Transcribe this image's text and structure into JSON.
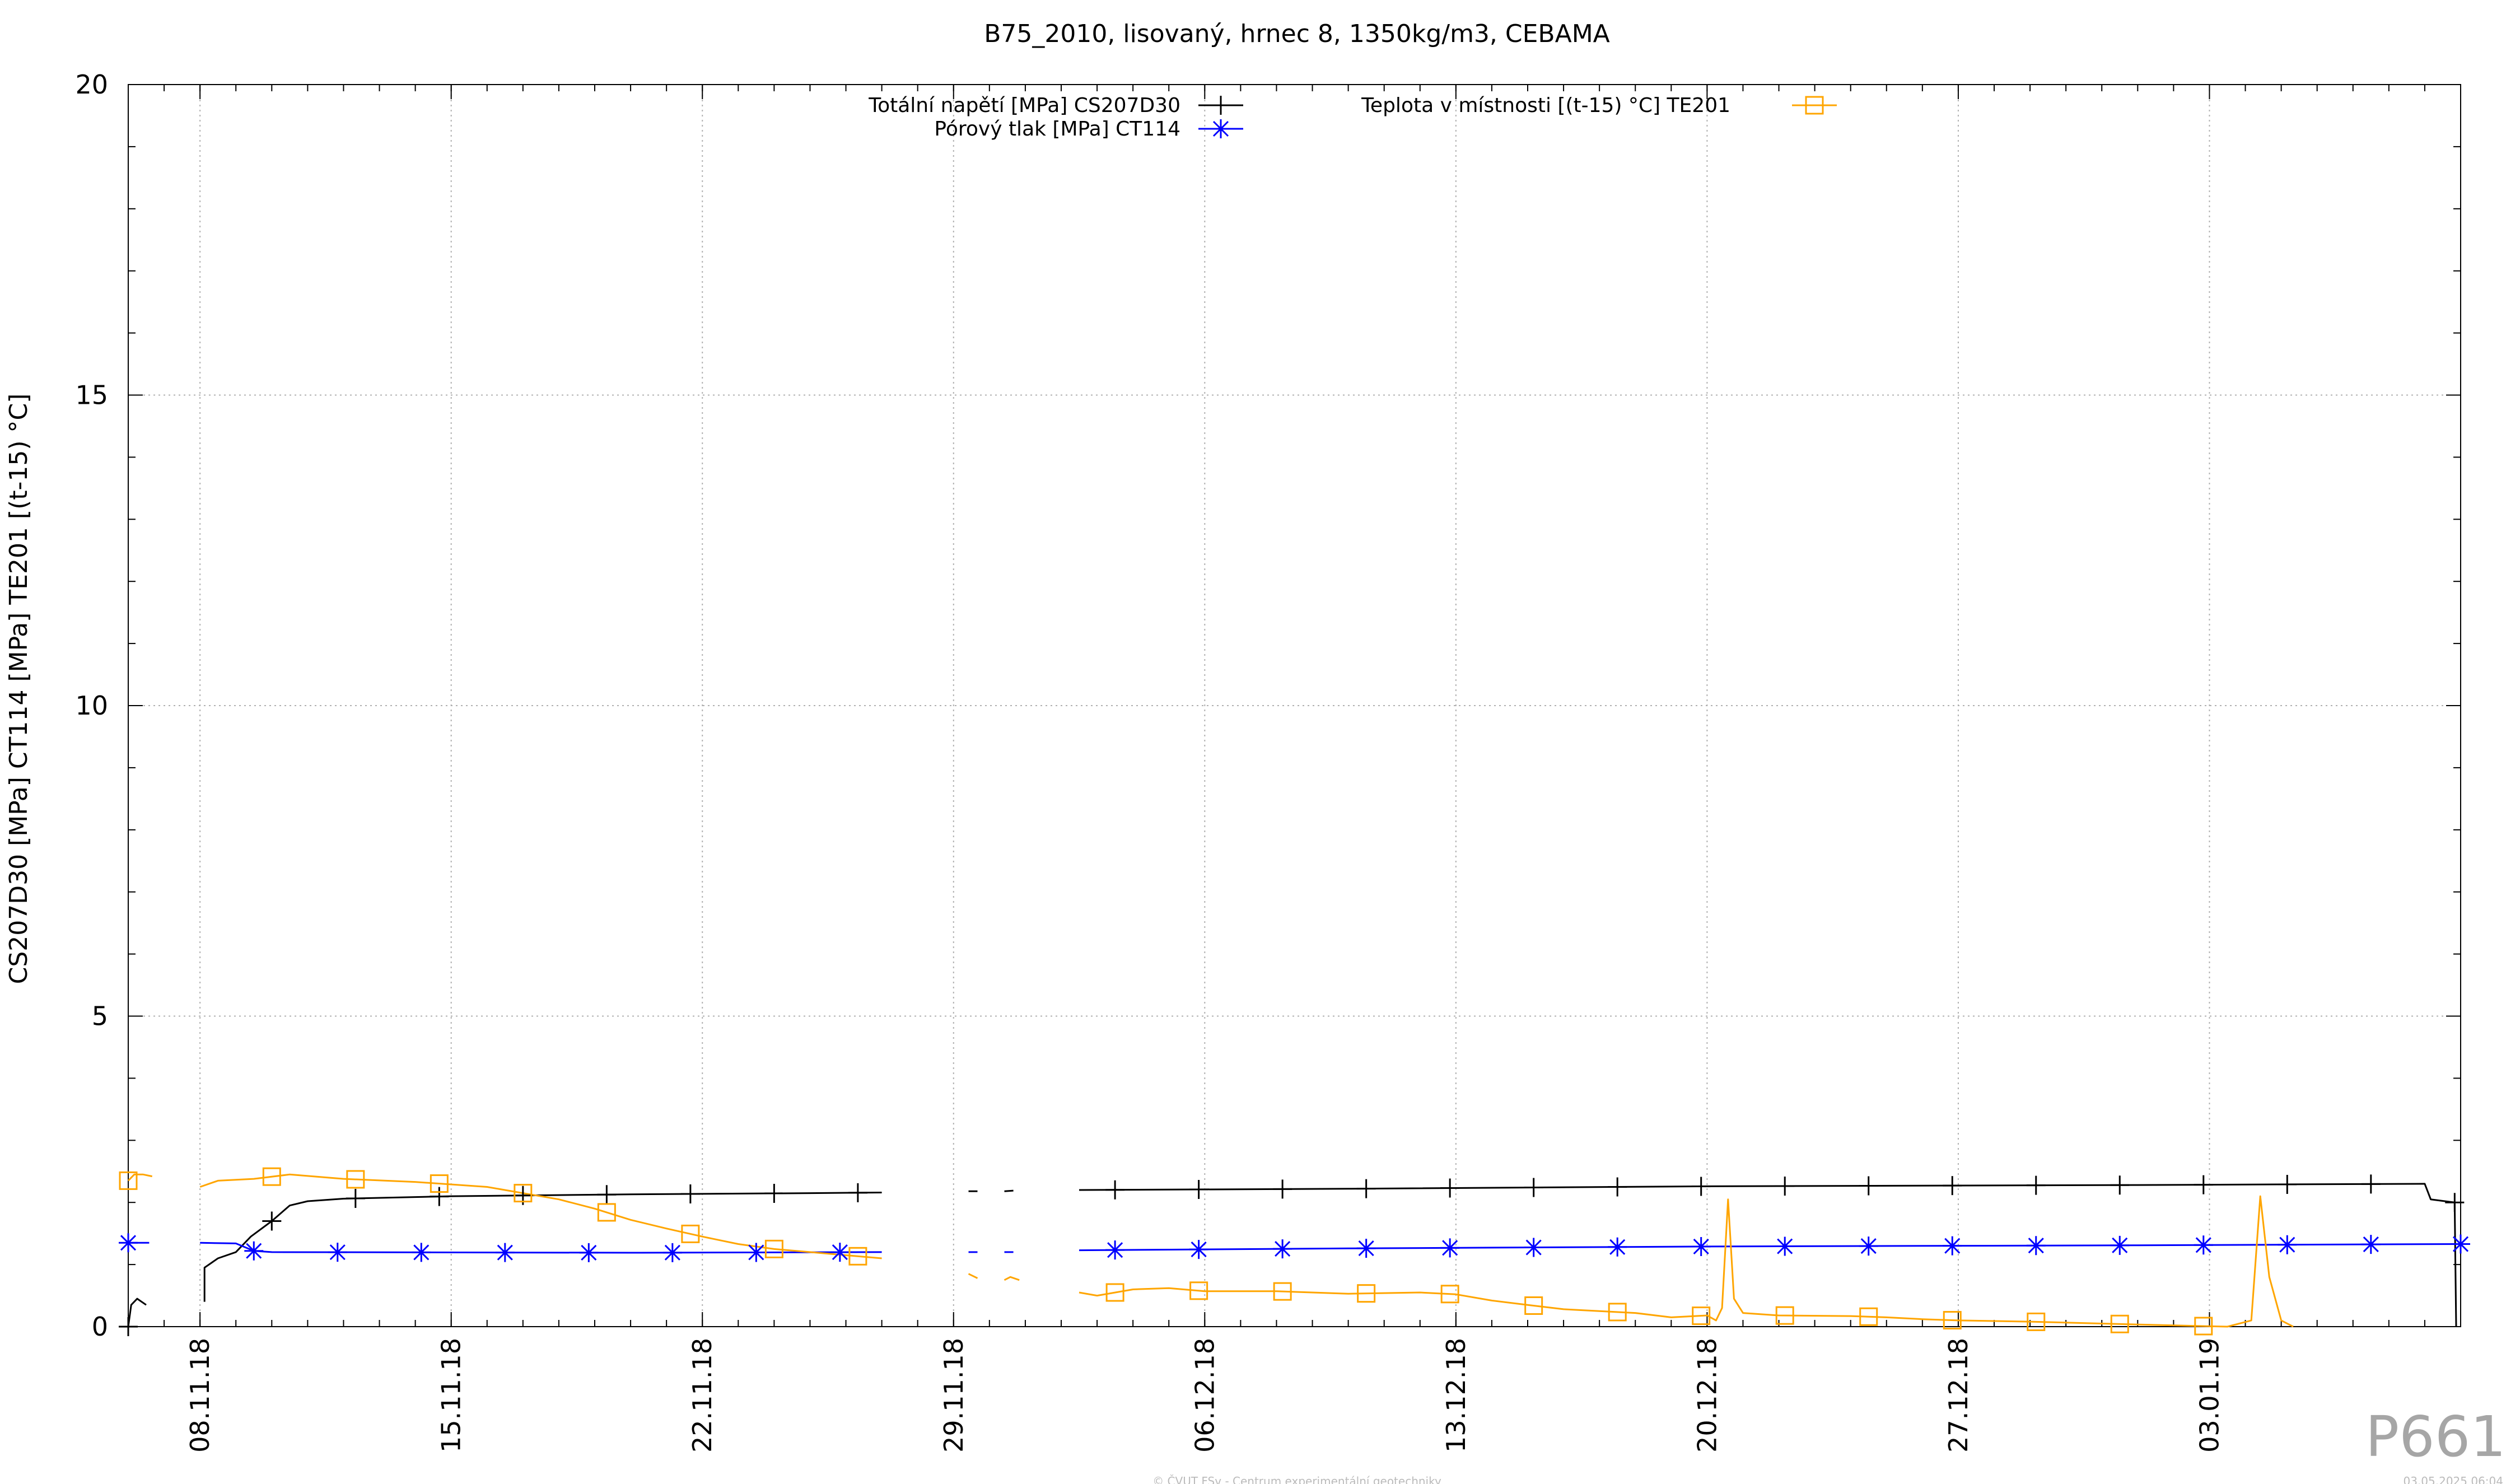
{
  "chart_data": {
    "type": "line",
    "title": "B75_2010, lisovaný, hrnec 8, 1350kg/m3, CEBAMA",
    "xlabel": "",
    "ylabel": "CS207D30 [MPa] CT114 [MPa] TE201 [(t-15) °C]",
    "x_axis": "date",
    "xlim": [
      "2018-11-06",
      "2019-01-10"
    ],
    "ylim": [
      0,
      20
    ],
    "x_ticks": [
      {
        "date": "2018-11-08",
        "label": "08.11.18"
      },
      {
        "date": "2018-11-15",
        "label": "15.11.18"
      },
      {
        "date": "2018-11-22",
        "label": "22.11.18"
      },
      {
        "date": "2018-11-29",
        "label": "29.11.18"
      },
      {
        "date": "2018-12-06",
        "label": "06.12.18"
      },
      {
        "date": "2018-12-13",
        "label": "13.12.18"
      },
      {
        "date": "2018-12-20",
        "label": "20.12.18"
      },
      {
        "date": "2018-12-27",
        "label": "27.12.18"
      },
      {
        "date": "2019-01-03",
        "label": "03.01.19"
      }
    ],
    "y_ticks": [
      0,
      5,
      10,
      15,
      20
    ],
    "grid": true,
    "legend_position": "top",
    "series": [
      {
        "name": "Totální napětí [MPa] CS207D30",
        "color": "#000000",
        "marker": "plus",
        "segments": [
          [
            [
              "2018-11-06T00:00",
              0.0
            ],
            [
              "2018-11-06T02:00",
              0.35
            ],
            [
              "2018-11-06T06:00",
              0.45
            ],
            [
              "2018-11-06T12:00",
              0.35
            ]
          ],
          [
            [
              "2018-11-08T03:00",
              0.4
            ],
            [
              "2018-11-08T03:00",
              0.95
            ],
            [
              "2018-11-08T06:00",
              1.0
            ],
            [
              "2018-11-08T12:00",
              1.1
            ],
            [
              "2018-11-09T00:00",
              1.2
            ],
            [
              "2018-11-09T10:00",
              1.45
            ],
            [
              "2018-11-10T00:00",
              1.7
            ],
            [
              "2018-11-10T12:00",
              1.95
            ],
            [
              "2018-11-11T00:00",
              2.02
            ],
            [
              "2018-11-12T00:00",
              2.06
            ],
            [
              "2018-11-15T00:00",
              2.1
            ],
            [
              "2018-11-20T00:00",
              2.13
            ],
            [
              "2018-11-25T00:00",
              2.15
            ],
            [
              "2018-11-27T00:00",
              2.16
            ]
          ],
          [
            [
              "2018-11-29T10:00",
              2.18
            ],
            [
              "2018-11-29T16:00",
              2.18
            ]
          ],
          [
            [
              "2018-11-30T10:00",
              2.18
            ],
            [
              "2018-11-30T16:00",
              2.19
            ]
          ],
          [
            [
              "2018-12-02T12:00",
              2.2
            ],
            [
              "2018-12-10T00:00",
              2.22
            ],
            [
              "2018-12-20T00:00",
              2.26
            ],
            [
              "2019-01-01T00:00",
              2.28
            ],
            [
              "2019-01-09T00:00",
              2.3
            ],
            [
              "2019-01-09T04:00",
              2.05
            ],
            [
              "2019-01-09T20:00",
              2.0
            ],
            [
              "2019-01-09T21:00",
              0.0
            ]
          ]
        ],
        "markers": [
          "2018-11-06T00:00",
          "2018-11-10T00:00",
          "2018-11-12T08:00",
          "2018-11-14T16:00",
          "2018-11-17T00:00",
          "2018-11-19T08:00",
          "2018-11-21T16:00",
          "2018-11-24T00:00",
          "2018-11-26T08:00",
          "2018-12-03T12:00",
          "2018-12-05T20:00",
          "2018-12-08T04:00",
          "2018-12-10T12:00",
          "2018-12-12T20:00",
          "2018-12-15T04:00",
          "2018-12-17T12:00",
          "2018-12-19T20:00",
          "2018-12-22T04:00",
          "2018-12-24T12:00",
          "2018-12-26T20:00",
          "2018-12-29T04:00",
          "2018-12-31T12:00",
          "2019-01-02T20:00",
          "2019-01-05T04:00",
          "2019-01-07T12:00",
          "2019-01-09T20:00"
        ]
      },
      {
        "name": "Pórový tlak [MPa] CT114",
        "color": "#0000ff",
        "marker": "star",
        "segments": [
          [
            [
              "2018-11-06T00:00",
              1.35
            ],
            [
              "2018-11-06T14:00",
              1.35
            ]
          ],
          [
            [
              "2018-11-08T00:00",
              1.35
            ],
            [
              "2018-11-09T00:00",
              1.34
            ],
            [
              "2018-11-09T12:00",
              1.22
            ],
            [
              "2018-11-10T00:00",
              1.2
            ],
            [
              "2018-11-20T00:00",
              1.19
            ],
            [
              "2018-11-27T00:00",
              1.2
            ]
          ],
          [
            [
              "2018-11-29T10:00",
              1.2
            ],
            [
              "2018-11-29T16:00",
              1.2
            ]
          ],
          [
            [
              "2018-11-30T10:00",
              1.2
            ],
            [
              "2018-11-30T16:00",
              1.2
            ]
          ],
          [
            [
              "2018-12-02T12:00",
              1.23
            ],
            [
              "2018-12-10T00:00",
              1.26
            ],
            [
              "2018-12-20T00:00",
              1.29
            ],
            [
              "2019-01-01T00:00",
              1.31
            ],
            [
              "2019-01-10T00:00",
              1.33
            ]
          ]
        ],
        "markers": [
          "2018-11-06T00:00",
          "2018-11-09T12:00",
          "2018-11-11T20:00",
          "2018-11-14T04:00",
          "2018-11-16T12:00",
          "2018-11-18T20:00",
          "2018-11-21T04:00",
          "2018-11-23T12:00",
          "2018-11-25T20:00",
          "2018-12-03T12:00",
          "2018-12-05T20:00",
          "2018-12-08T04:00",
          "2018-12-10T12:00",
          "2018-12-12T20:00",
          "2018-12-15T04:00",
          "2018-12-17T12:00",
          "2018-12-19T20:00",
          "2018-12-22T04:00",
          "2018-12-24T12:00",
          "2018-12-26T20:00",
          "2018-12-29T04:00",
          "2018-12-31T12:00",
          "2019-01-02T20:00",
          "2019-01-05T04:00",
          "2019-01-07T12:00",
          "2019-01-10T00:00"
        ]
      },
      {
        "name": "Teplota v místnosti [(t-15) °C] TE201",
        "color": "#ffa500",
        "marker": "square",
        "segments": [
          [
            [
              "2018-11-06T00:00",
              2.35
            ],
            [
              "2018-11-06T04:00",
              2.45
            ],
            [
              "2018-11-06T10:00",
              2.45
            ],
            [
              "2018-11-06T16:00",
              2.42
            ]
          ],
          [
            [
              "2018-11-08T00:00",
              2.25
            ],
            [
              "2018-11-08T12:00",
              2.35
            ],
            [
              "2018-11-09T12:00",
              2.38
            ],
            [
              "2018-11-10T12:00",
              2.45
            ],
            [
              "2018-11-12T00:00",
              2.38
            ],
            [
              "2018-11-14T00:00",
              2.33
            ],
            [
              "2018-11-16T00:00",
              2.25
            ],
            [
              "2018-11-17T00:00",
              2.15
            ],
            [
              "2018-11-18T00:00",
              2.05
            ],
            [
              "2018-11-19T00:00",
              1.9
            ],
            [
              "2018-11-20T00:00",
              1.72
            ],
            [
              "2018-11-21T00:00",
              1.58
            ],
            [
              "2018-11-22T00:00",
              1.45
            ],
            [
              "2018-11-23T00:00",
              1.33
            ],
            [
              "2018-11-24T00:00",
              1.25
            ],
            [
              "2018-11-25T00:00",
              1.2
            ],
            [
              "2018-11-27T00:00",
              1.1
            ]
          ],
          [
            [
              "2018-11-29T10:00",
              0.85
            ],
            [
              "2018-11-29T16:00",
              0.78
            ]
          ],
          [
            [
              "2018-11-30T10:00",
              0.75
            ],
            [
              "2018-11-30T14:00",
              0.8
            ],
            [
              "2018-11-30T20:00",
              0.75
            ]
          ],
          [
            [
              "2018-12-02T12:00",
              0.55
            ],
            [
              "2018-12-03T00:00",
              0.5
            ],
            [
              "2018-12-04T00:00",
              0.6
            ],
            [
              "2018-12-05T00:00",
              0.62
            ],
            [
              "2018-12-06T00:00",
              0.57
            ],
            [
              "2018-12-08T00:00",
              0.57
            ],
            [
              "2018-12-10T00:00",
              0.53
            ],
            [
              "2018-12-12T00:00",
              0.55
            ],
            [
              "2018-12-13T00:00",
              0.52
            ],
            [
              "2018-12-14T00:00",
              0.42
            ],
            [
              "2018-12-15T00:00",
              0.35
            ],
            [
              "2018-12-16T00:00",
              0.28
            ],
            [
              "2018-12-17T00:00",
              0.25
            ],
            [
              "2018-12-18T00:00",
              0.22
            ],
            [
              "2018-12-19T00:00",
              0.15
            ],
            [
              "2018-12-20T00:00",
              0.18
            ],
            [
              "2018-12-20T06:00",
              0.1
            ],
            [
              "2018-12-20T10:00",
              0.3
            ],
            [
              "2018-12-20T14:00",
              2.05
            ],
            [
              "2018-12-20T18:00",
              0.45
            ],
            [
              "2018-12-21T00:00",
              0.22
            ],
            [
              "2018-12-22T00:00",
              0.18
            ],
            [
              "2018-12-24T00:00",
              0.17
            ],
            [
              "2018-12-25T00:00",
              0.15
            ],
            [
              "2018-12-26T00:00",
              0.12
            ],
            [
              "2018-12-27T00:00",
              0.1
            ],
            [
              "2018-12-29T00:00",
              0.08
            ],
            [
              "2018-12-31T00:00",
              0.05
            ],
            [
              "2019-01-02T00:00",
              0.02
            ],
            [
              "2019-01-03T12:00",
              0.0
            ],
            [
              "2019-01-04T04:00",
              0.1
            ],
            [
              "2019-01-04T10:00",
              2.1
            ],
            [
              "2019-01-04T16:00",
              0.8
            ],
            [
              "2019-01-05T00:00",
              0.1
            ],
            [
              "2019-01-05T08:00",
              0.0
            ]
          ]
        ],
        "markers": [
          "2018-11-06T00:00",
          "2018-11-10T00:00",
          "2018-11-12T08:00",
          "2018-11-14T16:00",
          "2018-11-17T00:00",
          "2018-11-19T08:00",
          "2018-11-21T16:00",
          "2018-11-24T00:00",
          "2018-11-26T08:00",
          "2018-12-03T12:00",
          "2018-12-05T20:00",
          "2018-12-08T04:00",
          "2018-12-10T12:00",
          "2018-12-12T20:00",
          "2018-12-15T04:00",
          "2018-12-17T12:00",
          "2018-12-19T20:00",
          "2018-12-22T04:00",
          "2018-12-24T12:00",
          "2018-12-26T20:00",
          "2018-12-29T04:00",
          "2018-12-31T12:00",
          "2019-01-02T20:00"
        ]
      }
    ]
  },
  "watermark": {
    "code": "P661",
    "copyright": "© ČVUT FSv - Centrum experimentální geotechniky",
    "timestamp": "03.05.2025 06:04"
  }
}
